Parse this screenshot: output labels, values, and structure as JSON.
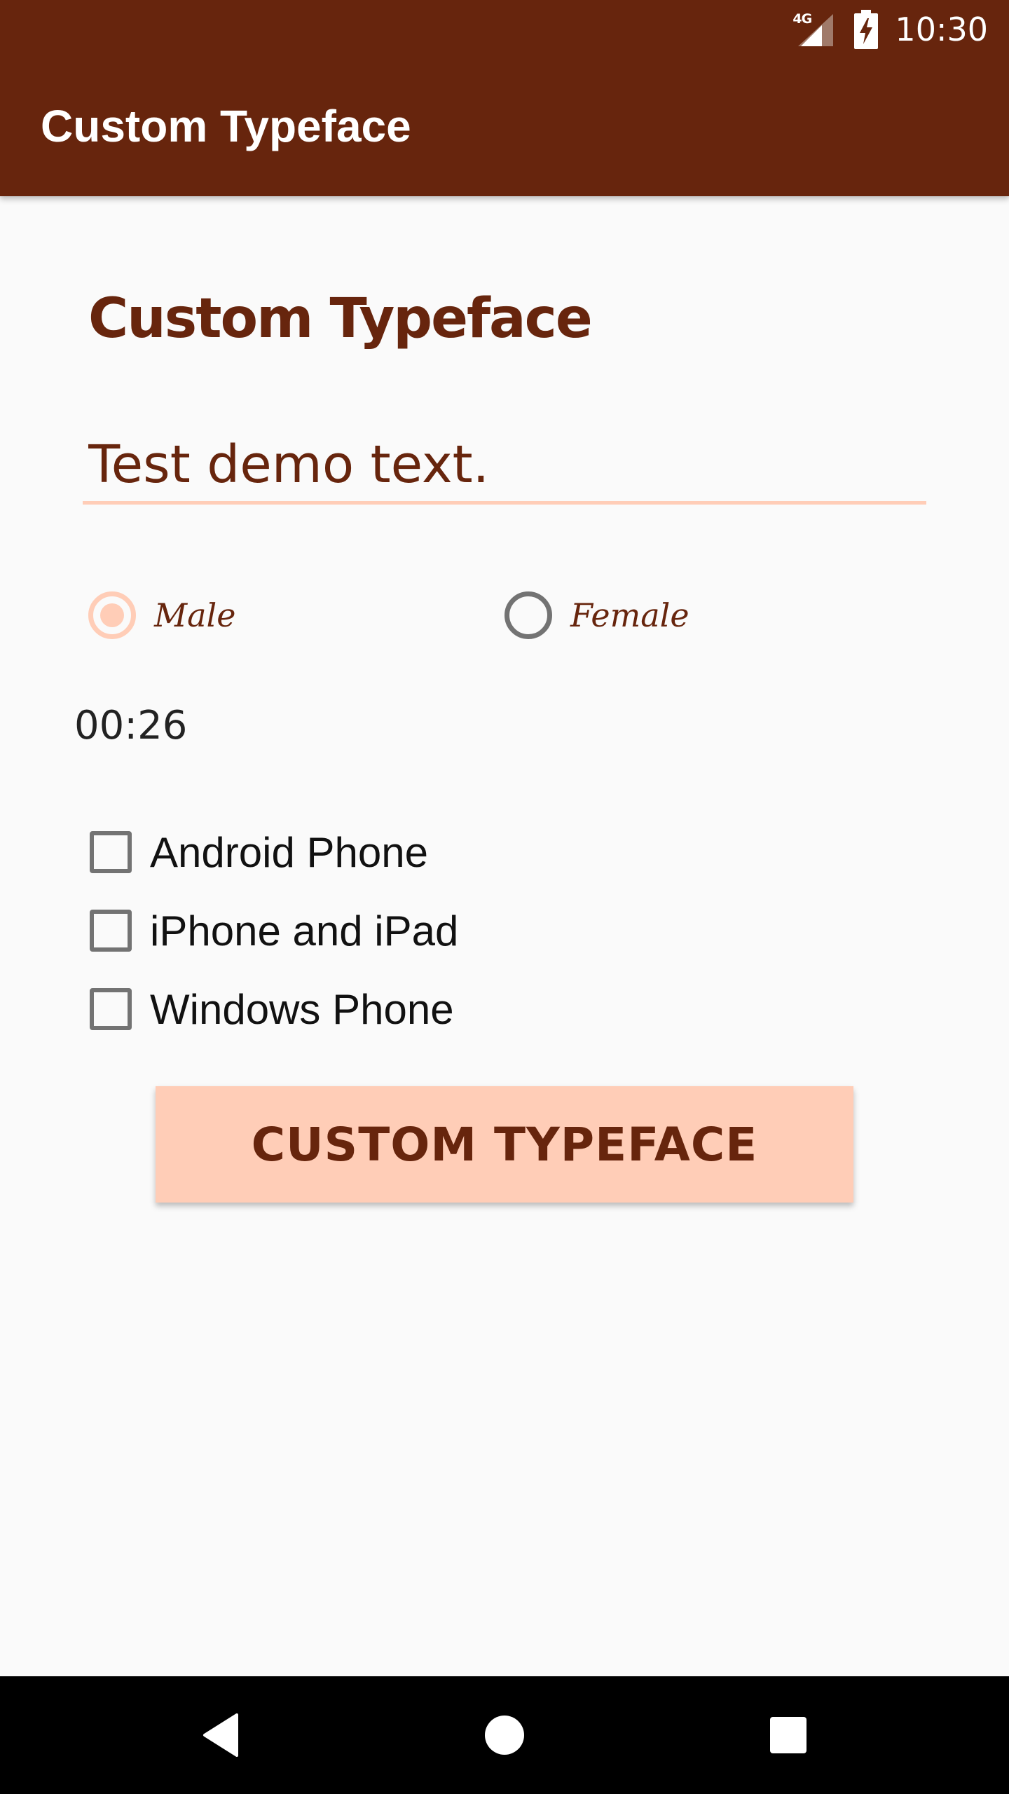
{
  "status_bar": {
    "network_label": "4G",
    "time": "10:30"
  },
  "app_bar": {
    "title": "Custom Typeface"
  },
  "content": {
    "heading": "Custom Typeface",
    "text_field": {
      "value": "Test demo text.",
      "placeholder": ""
    },
    "radios": [
      {
        "label": "Male",
        "checked": true
      },
      {
        "label": "Female",
        "checked": false
      }
    ],
    "timer": "00:26",
    "checkboxes": [
      {
        "label": "Android Phone",
        "checked": false
      },
      {
        "label": "iPhone and iPad",
        "checked": false
      },
      {
        "label": "Windows Phone",
        "checked": false
      }
    ],
    "button_label": "CUSTOM TYPEFACE"
  },
  "nav_bar": {
    "icons": [
      "back-icon",
      "home-icon",
      "recents-icon"
    ]
  },
  "colors": {
    "primary_dark": "#67250d",
    "accent": "#ffcdb7",
    "background": "#fafafa",
    "control_gray": "#737373"
  }
}
